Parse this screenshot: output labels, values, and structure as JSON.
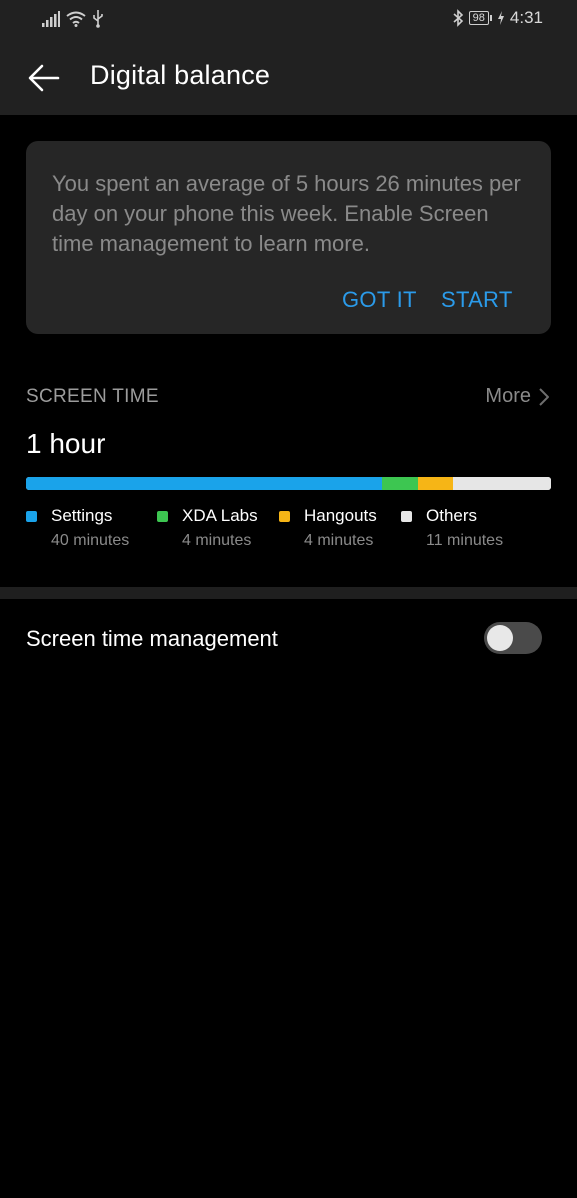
{
  "status_bar": {
    "battery": "98",
    "time": "4:31",
    "icons": [
      "signal-icon",
      "wifi-icon",
      "usb-icon",
      "bluetooth-icon",
      "charging-icon"
    ]
  },
  "app_bar": {
    "title": "Digital balance",
    "back_icon": "arrow-left-icon"
  },
  "card": {
    "message": "You spent an average of 5 hours 26 minutes per day on your phone this week. Enable Screen time management to learn more.",
    "got_it_label": "GOT IT",
    "start_label": "START",
    "accent": "#2b9bea"
  },
  "screen_time": {
    "section_label": "SCREEN TIME",
    "more_label": "More",
    "total": "1 hour",
    "apps": [
      {
        "name": "Settings",
        "time": "40 minutes",
        "minutes": 40,
        "color": "#1aa3ea"
      },
      {
        "name": "XDA Labs",
        "time": "4 minutes",
        "minutes": 4,
        "color": "#3dc651"
      },
      {
        "name": "Hangouts",
        "time": "4 minutes",
        "minutes": 4,
        "color": "#f6b516"
      },
      {
        "name": "Others",
        "time": "11 minutes",
        "minutes": 11,
        "color": "#e6e6e6"
      }
    ]
  },
  "management": {
    "label": "Screen time management",
    "enabled": false
  }
}
